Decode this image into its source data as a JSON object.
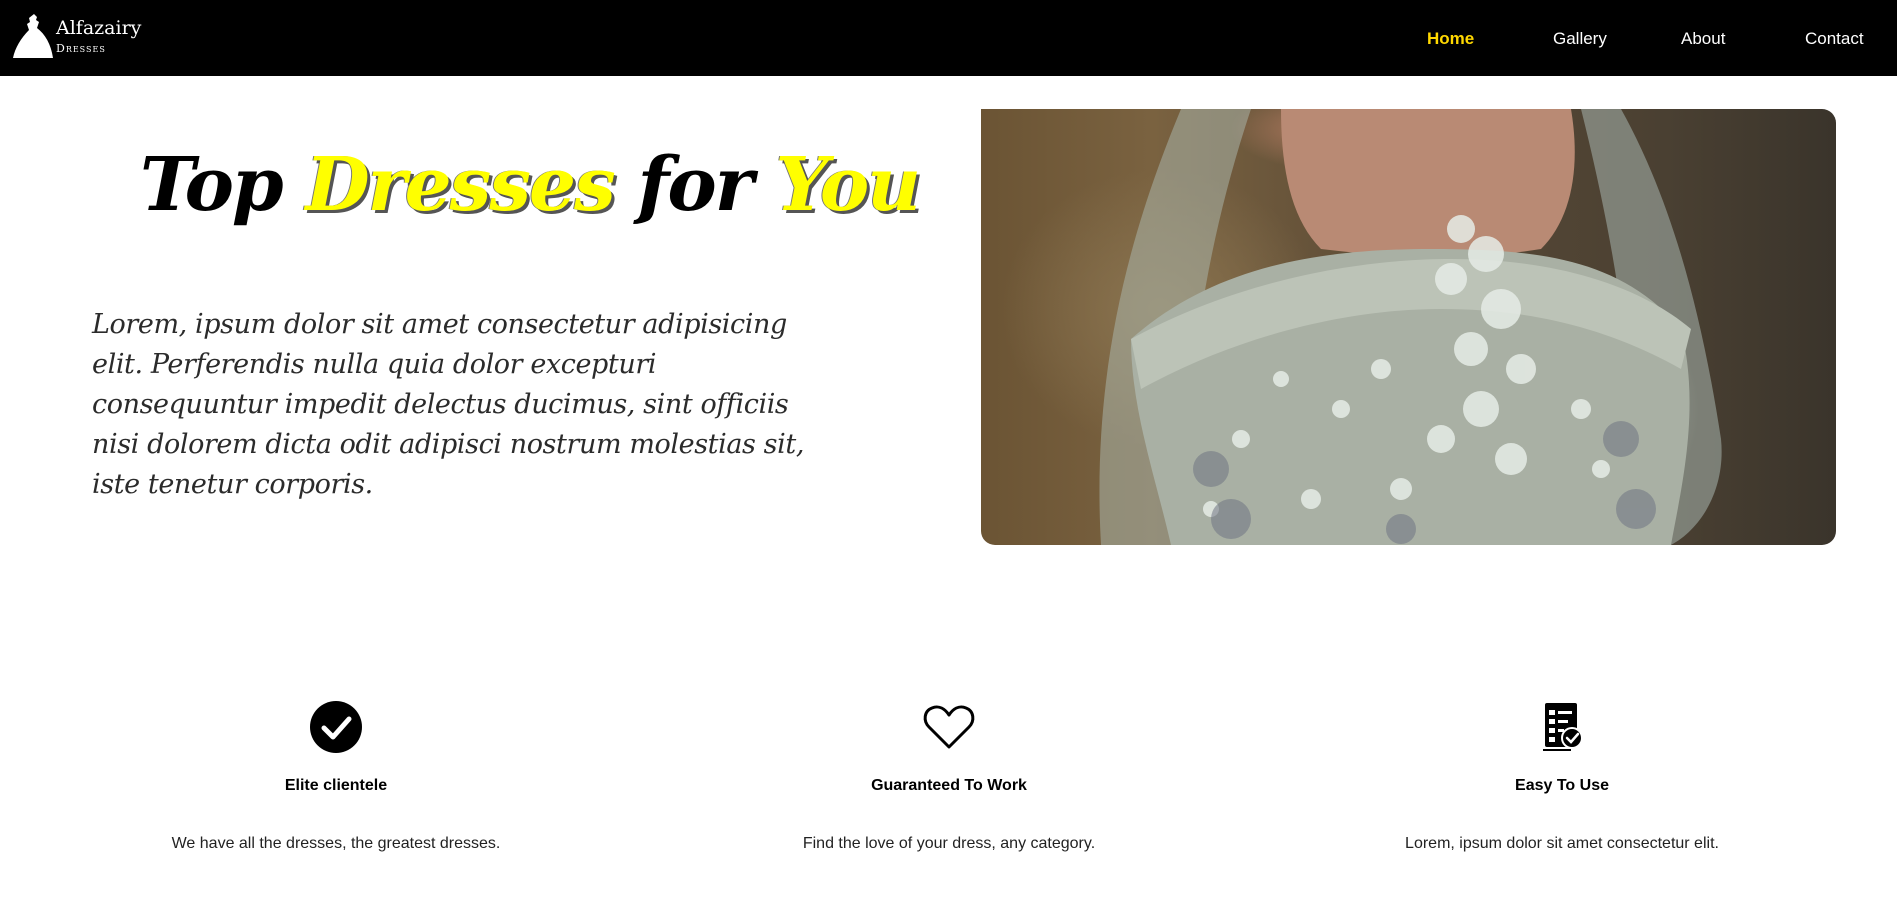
{
  "brand": {
    "name": "Alfazairy",
    "subtitle": "Dresses",
    "logo_icon": "dress-silhouette-icon"
  },
  "nav": {
    "items": [
      {
        "label": "Home",
        "active": true
      },
      {
        "label": "Gallery",
        "active": false
      },
      {
        "label": "About",
        "active": false
      },
      {
        "label": "Contact",
        "active": false
      }
    ]
  },
  "hero": {
    "title_parts": [
      "Top ",
      "Dresses",
      " for ",
      "You"
    ],
    "body": "Lorem, ipsum dolor sit amet consectetur adipisicing elit. Perferendis nulla quia dolor excepturi consequuntur impedit delectus ducimus, sint officiis nisi dolorem dicta odit adipisci nostrum molestias sit, iste tenetur corporis.",
    "image_icon": "wedding-dress-photo"
  },
  "features": [
    {
      "icon": "check-circle-icon",
      "title": "Elite clientele",
      "description": "We have all the dresses, the greatest dresses."
    },
    {
      "icon": "heart-icon",
      "title": "Guaranteed To Work",
      "description": "Find the love of your dress, any category."
    },
    {
      "icon": "checklist-icon",
      "title": "Easy To Use",
      "description": "Lorem, ipsum dolor sit amet consectetur elit."
    }
  ],
  "colors": {
    "nav_bg": "#000000",
    "accent": "#ffd800",
    "highlight": "#ffff00"
  }
}
